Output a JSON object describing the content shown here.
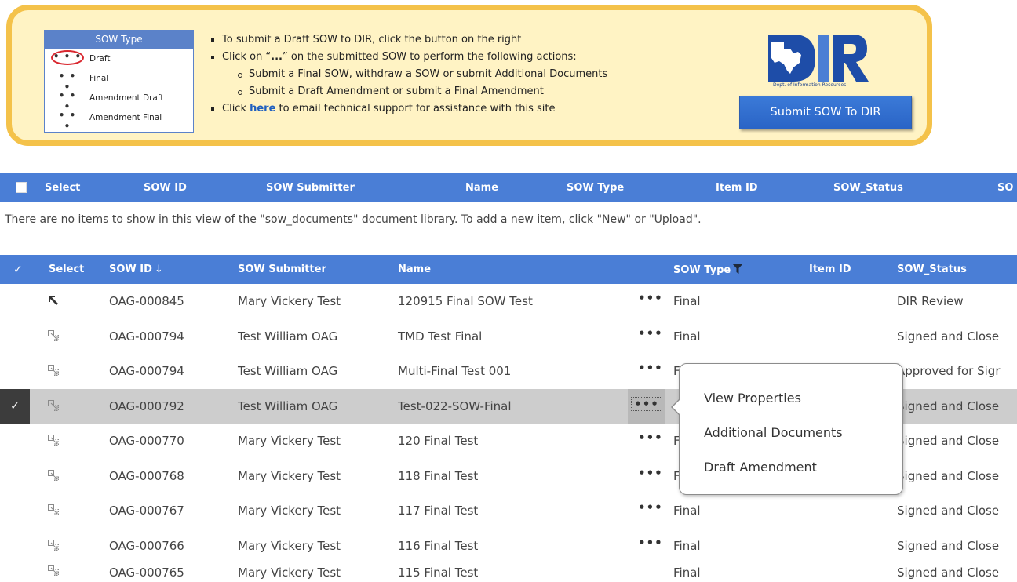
{
  "banner": {
    "legend": {
      "title": "SOW Type",
      "items": [
        {
          "dots": "• • •",
          "label": "Draft",
          "circled": true
        },
        {
          "dots": "• • •",
          "label": "Final"
        },
        {
          "dots": "• • •",
          "label": "Amendment Draft"
        },
        {
          "dots": "• • •",
          "label": "Amendment Final"
        }
      ]
    },
    "instructions": {
      "line1": "To submit a Draft SOW to DIR, click the button on the right",
      "line2_pre": "Click on “",
      "line2_dots": "...",
      "line2_post": "” on the submitted SOW to perform the following actions:",
      "sub1": "Submit a Final SOW, withdraw a SOW or submit Additional Documents",
      "sub2": "Submit a Draft Amendment or submit a Final Amendment",
      "line3_pre": "Click ",
      "line3_link": "here",
      "line3_post": " to email technical support for assistance with this site"
    },
    "logo": {
      "caption": "Dept. of Information Resources",
      "colors": {
        "blue": "#1e4da8",
        "light": "#4b7fd4"
      }
    },
    "submit_button": "Submit SOW To DIR"
  },
  "top_table": {
    "headers": [
      "Select",
      "SOW ID",
      "SOW Submitter",
      "Name",
      "SOW Type",
      "Item ID",
      "SOW_Status",
      "SO"
    ],
    "empty_message": "There are no items to show in this view of the \"sow_documents\" document library. To add a new item, click \"New\" or \"Upload\"."
  },
  "main_table": {
    "check_glyph": "✓",
    "headers": {
      "select": "Select",
      "sow_id": "SOW ID",
      "sort_icon": "↓",
      "submitter": "SOW Submitter",
      "name": "Name",
      "sow_type": "SOW Type",
      "item_id": "Item ID",
      "status": "SOW_Status"
    },
    "rows": [
      {
        "sow_id": "OAG-000845",
        "submitter": "Mary Vickery Test",
        "name": "120915 Final SOW Test",
        "ellipsis": "•••",
        "type": "Final",
        "status": "DIR Review"
      },
      {
        "sow_id": "OAG-000794",
        "submitter": "Test William OAG",
        "name": "TMD Test Final",
        "ellipsis": "•••",
        "type": "Final",
        "status": "Signed and Close"
      },
      {
        "sow_id": "OAG-000794",
        "submitter": "Test William OAG",
        "name": "Multi-Final Test 001",
        "ellipsis": "•••",
        "type": "F",
        "status": "Approved for Sigr"
      },
      {
        "sow_id": "OAG-000792",
        "submitter": "Test William OAG",
        "name": "Test-022-SOW-Final",
        "ellipsis": "•••",
        "type": "",
        "status": "Signed and Close",
        "selected": true
      },
      {
        "sow_id": "OAG-000770",
        "submitter": "Mary Vickery Test",
        "name": "120 Final Test",
        "ellipsis": "•••",
        "type": "F",
        "status": "Signed and Close"
      },
      {
        "sow_id": "OAG-000768",
        "submitter": "Mary Vickery Test",
        "name": "118 Final Test",
        "ellipsis": "•••",
        "type": "F",
        "status": "Signed and Close"
      },
      {
        "sow_id": "OAG-000767",
        "submitter": "Mary Vickery Test",
        "name": "117 Final Test",
        "ellipsis": "•••",
        "type": "Final",
        "status": "Signed and Close"
      },
      {
        "sow_id": "OAG-000766",
        "submitter": "Mary Vickery Test",
        "name": "116 Final Test",
        "ellipsis": "•••",
        "type": "Final",
        "status": "Signed and Close"
      },
      {
        "sow_id": "OAG-000765",
        "submitter": "Mary Vickery Test",
        "name": "115 Final Test",
        "ellipsis": "",
        "type": "Final",
        "status": "Signed and Close"
      }
    ]
  },
  "callout_menu": {
    "items": [
      "View Properties",
      "Additional Documents",
      "Draft Amendment"
    ]
  }
}
